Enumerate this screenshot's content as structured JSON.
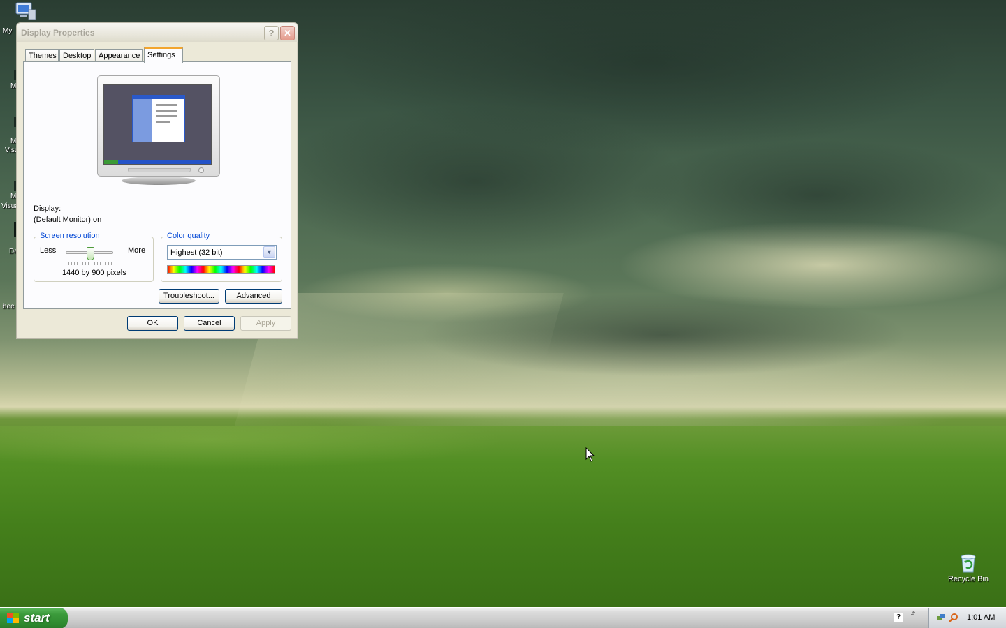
{
  "desktop": {
    "icons": {
      "recycle_bin": "Recycle Bin"
    },
    "partial_labels": {
      "l1": "My",
      "l2": "M",
      "l3": "M",
      "l4": "Visu",
      "l5": "M",
      "l6": "Visua",
      "l7": "De",
      "l8": "bee"
    }
  },
  "dialog": {
    "title": "Display Properties",
    "help_symbol": "?",
    "close_symbol": "✕",
    "tabs": [
      "Themes",
      "Desktop",
      "Appearance",
      "Settings"
    ],
    "active_tab": "Settings",
    "display_label": "Display:",
    "display_value": "(Default Monitor) on",
    "resolution": {
      "legend": "Screen resolution",
      "less": "Less",
      "more": "More",
      "value": "1440 by 900 pixels",
      "slider_fraction": 0.52
    },
    "color_quality": {
      "legend": "Color quality",
      "selected": "Highest (32 bit)"
    },
    "buttons": {
      "troubleshoot": "Troubleshoot...",
      "advanced": "Advanced",
      "ok": "OK",
      "cancel": "Cancel",
      "apply": "Apply"
    }
  },
  "taskbar": {
    "start_label": "start",
    "clock": "1:01 AM"
  },
  "colors": {
    "xp_blue": "#0046d5",
    "start_green": "#3c9b3c",
    "active_tab_accent": "#f2a52e"
  }
}
